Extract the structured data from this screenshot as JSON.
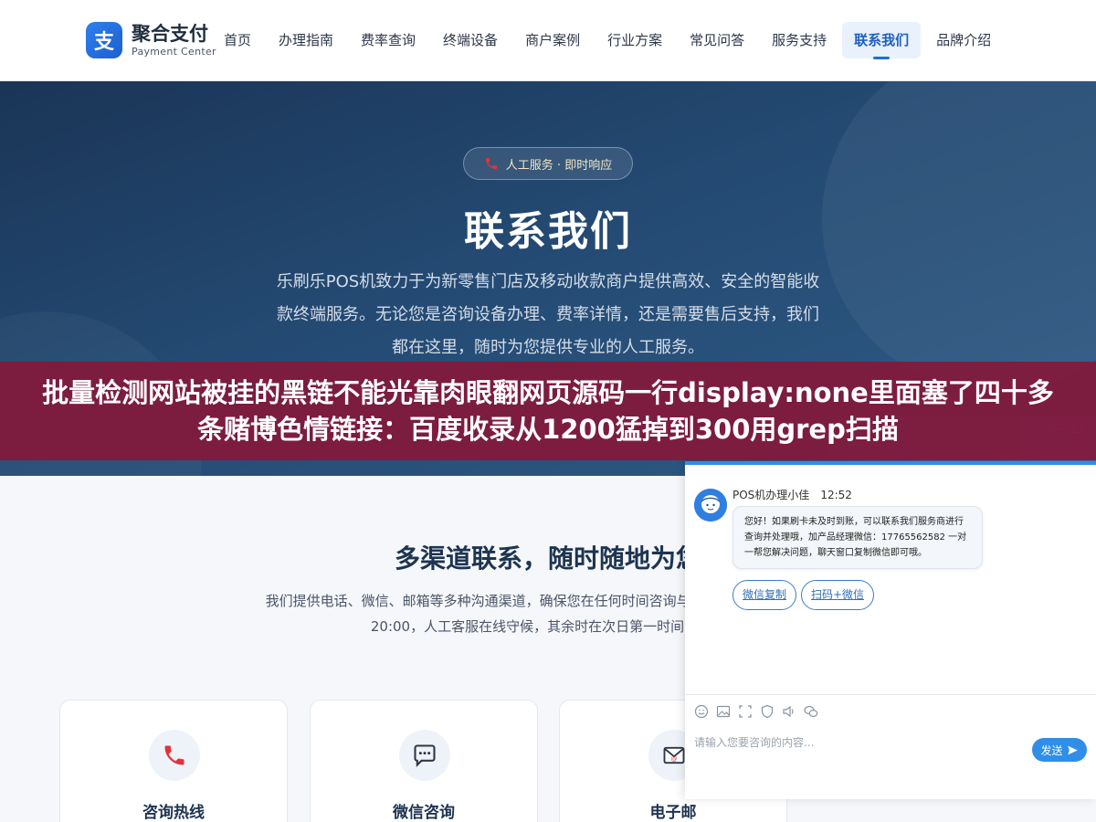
{
  "header": {
    "logo_mark": "支",
    "logo_title": "聚合支付",
    "logo_sub": "Payment Center",
    "nav": [
      {
        "label": "首页"
      },
      {
        "label": "办理指南"
      },
      {
        "label": "费率查询"
      },
      {
        "label": "终端设备"
      },
      {
        "label": "商户案例"
      },
      {
        "label": "行业方案"
      },
      {
        "label": "常见问答"
      },
      {
        "label": "服务支持"
      },
      {
        "label": "联系我们",
        "active": true
      },
      {
        "label": "品牌介绍"
      }
    ]
  },
  "hero": {
    "pill_icon": "phone-icon",
    "pill": "人工服务 · 即时响应",
    "title": "联系我们",
    "desc": "乐刷乐POS机致力于为新零售门店及移动收款商户提供高效、安全的智能收款终端服务。无论您是咨询设备办理、费率详情，还是需要售后支持，我们都在这里，随时为您提供专业的人工服务。"
  },
  "banner": {
    "text": "批量检测网站被挂的黑链不能光靠肉眼翻网页源码一行display:none里面塞了四十多条赌博色情链接：百度收录从1200猛掉到300用grep扫描"
  },
  "channels": {
    "title": "多渠道联系，随时随地为您",
    "desc": "我们提供电话、微信、邮箱等多种沟通渠道，确保您在任何时间咨询与办理支持。每日8:30至20:00，人工客服在线守候，其余时在次日第一时间回复。",
    "cards": [
      {
        "icon": "phone-icon",
        "title": "咨询热线"
      },
      {
        "icon": "chat-icon",
        "title": "微信咨询"
      },
      {
        "icon": "mail-icon",
        "title": "电子邮"
      }
    ]
  },
  "chat": {
    "agent_name": "POS机办理小佳",
    "time": "12:52",
    "message": "您好！如果刷卡未及时到账，可以联系我们服务商进行查询并处理哦，加产品经理微信：17765562582 一对一帮您解决问题，聊天窗口复制微信即可哦。",
    "buttons": [
      "微信复制",
      "扫码+微信"
    ],
    "tools": [
      "emoji-icon",
      "image-icon",
      "screenshot-icon",
      "shield-icon",
      "audio-icon",
      "wechat-icon"
    ],
    "input_placeholder": "请输入您要咨询的内容...",
    "send_label": "发送",
    "colors": {
      "accent": "#2f8fe8",
      "banner": "#821a3c",
      "hero": "#244a73"
    }
  }
}
